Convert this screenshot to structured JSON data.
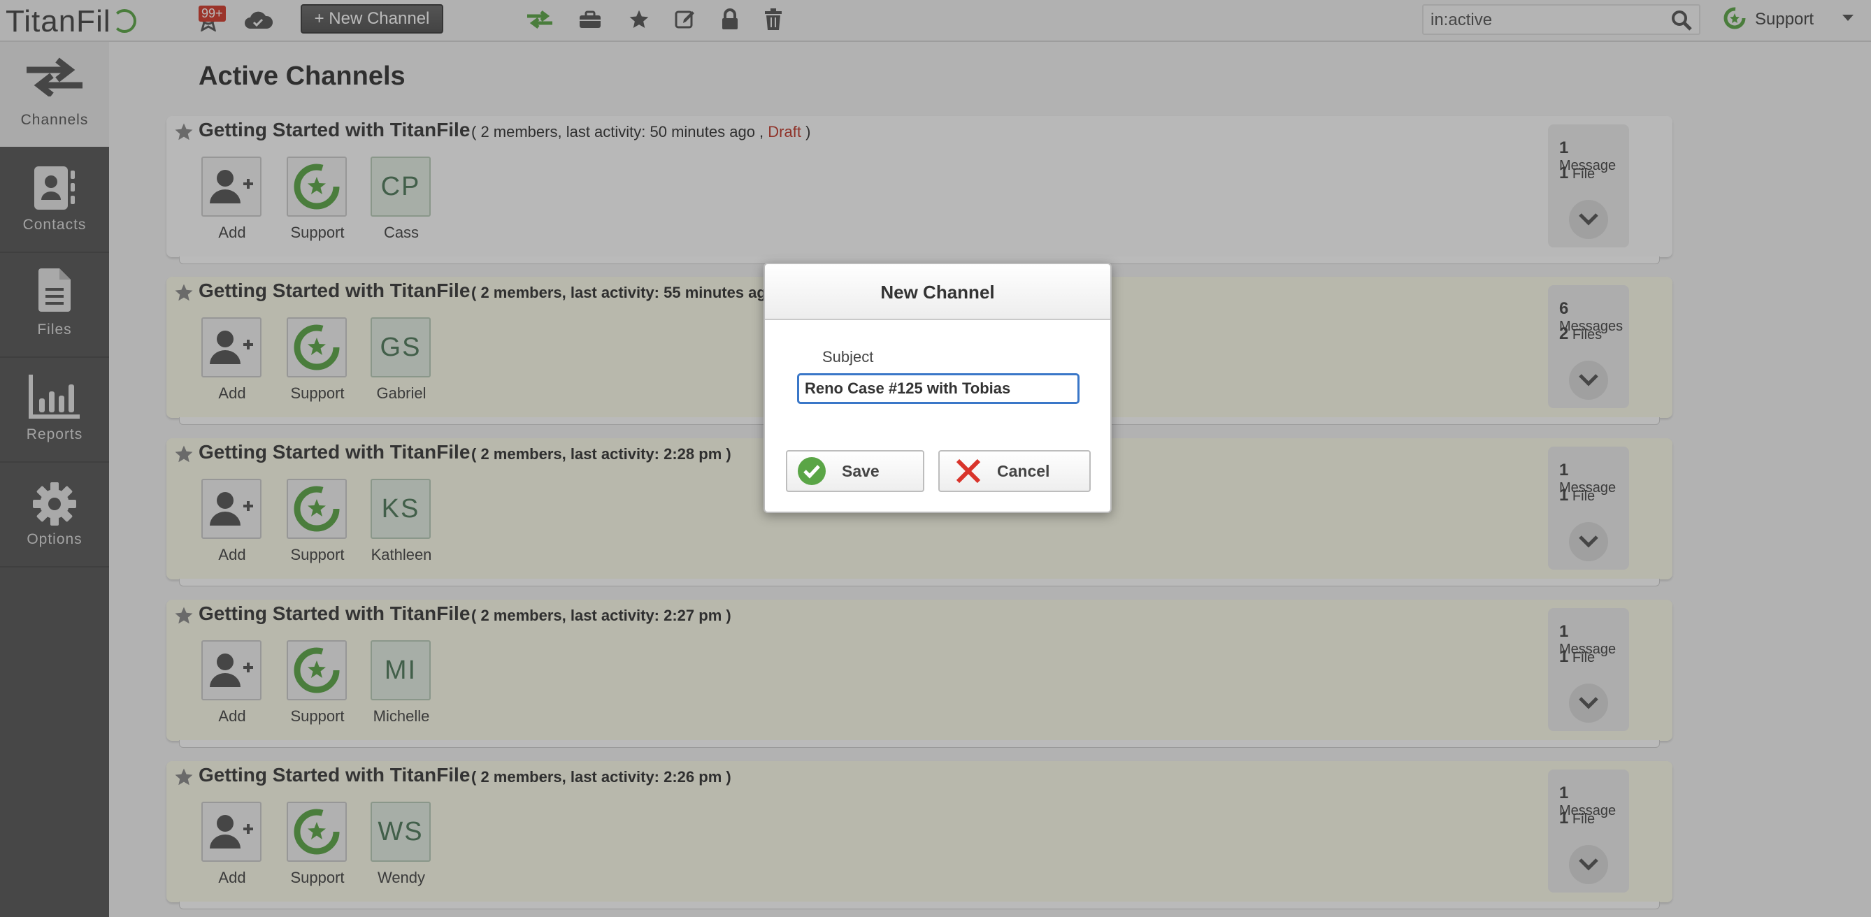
{
  "app": {
    "logo_text": "TitanFil"
  },
  "topbar": {
    "notification_badge": "99+",
    "new_channel_label": "+ New Channel",
    "search": {
      "value": "in:active",
      "placeholder": ""
    },
    "user_name": "Support"
  },
  "sidebar": {
    "items": [
      {
        "label": "Channels",
        "icon": "channels-arrows-icon",
        "active": true
      },
      {
        "label": "Contacts",
        "icon": "contacts-icon",
        "active": false
      },
      {
        "label": "Files",
        "icon": "files-icon",
        "active": false
      },
      {
        "label": "Reports",
        "icon": "reports-bar-chart-icon",
        "active": false
      },
      {
        "label": "Options",
        "icon": "gear-icon",
        "active": false
      }
    ]
  },
  "main": {
    "title": "Active Channels",
    "add_label": "Add",
    "channels": [
      {
        "title": "Getting Started with TitanFile",
        "meta": "( 2 members, last activity: 50 minutes ago ,",
        "draft": "Draft",
        "meta_end": " )",
        "members": [
          {
            "name": "Support"
          },
          {
            "name": "Cass",
            "initials": "CP"
          }
        ],
        "messages_count": "1",
        "messages_label": "Message",
        "files_count": "1",
        "files_label": "File"
      },
      {
        "title": "Getting Started with TitanFile",
        "meta": "( 2 members, last activity: 55 minutes ago )",
        "members": [
          {
            "name": "Support"
          },
          {
            "name": "Gabriel",
            "initials": "GS"
          }
        ],
        "messages_count": "6",
        "messages_label": "Messages",
        "files_count": "2",
        "files_label": "Files"
      },
      {
        "title": "Getting Started with TitanFile",
        "meta": "( 2 members, last activity: 2:28 pm )",
        "members": [
          {
            "name": "Support"
          },
          {
            "name": "Kathleen",
            "initials": "KS"
          }
        ],
        "messages_count": "1",
        "messages_label": "Message",
        "files_count": "1",
        "files_label": "File"
      },
      {
        "title": "Getting Started with TitanFile",
        "meta": "( 2 members, last activity: 2:27 pm )",
        "members": [
          {
            "name": "Support"
          },
          {
            "name": "Michelle",
            "initials": "MI"
          }
        ],
        "messages_count": "1",
        "messages_label": "Message",
        "files_count": "1",
        "files_label": "File"
      },
      {
        "title": "Getting Started with TitanFile",
        "meta": "( 2 members, last activity: 2:26 pm )",
        "members": [
          {
            "name": "Support"
          },
          {
            "name": "Wendy",
            "initials": "WS"
          }
        ],
        "messages_count": "1",
        "messages_label": "Message",
        "files_count": "1",
        "files_label": "File"
      }
    ]
  },
  "modal": {
    "title": "New Channel",
    "subject_label": "Subject",
    "subject_value": "Reno Case #125 with Tobias",
    "save_label": "Save",
    "cancel_label": "Cancel"
  },
  "colors": {
    "accent_green": "#5aa546",
    "draft_red": "#c0392b",
    "focus_blue": "#3a77c8",
    "sidebar": "#565656"
  }
}
